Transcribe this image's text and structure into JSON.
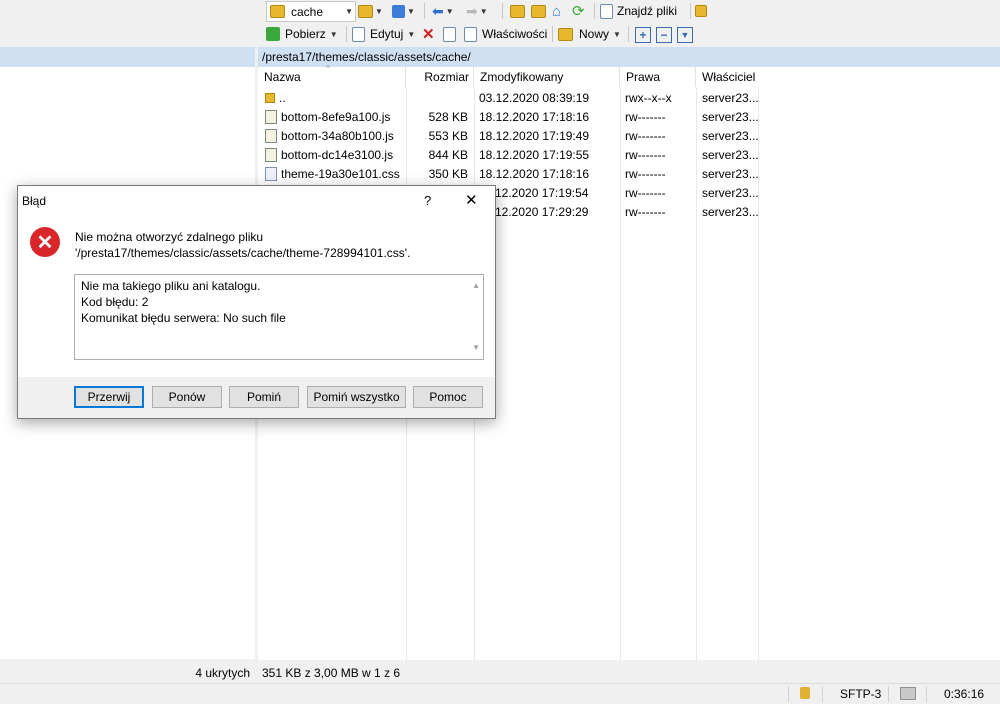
{
  "toolbar": {
    "location": "cache",
    "find_files": "Znajdź pliki",
    "download": "Pobierz",
    "edit": "Edytuj",
    "properties": "Właściwości",
    "new": "Nowy",
    "plus": "+",
    "minus": "−"
  },
  "path": "/presta17/themes/classic/assets/cache/",
  "columns": {
    "name": "Nazwa",
    "size": "Rozmiar",
    "modified": "Zmodyfikowany",
    "rights": "Prawa",
    "owner": "Właściciel"
  },
  "files": [
    {
      "name": "..",
      "size": "",
      "modified": "03.12.2020 08:39:19",
      "rights": "rwx--x--x",
      "owner": "server23..."
    },
    {
      "name": "bottom-8efe9a100.js",
      "size": "528 KB",
      "modified": "18.12.2020 17:18:16",
      "rights": "rw-------",
      "owner": "server23..."
    },
    {
      "name": "bottom-34a80b100.js",
      "size": "553 KB",
      "modified": "18.12.2020 17:19:49",
      "rights": "rw-------",
      "owner": "server23..."
    },
    {
      "name": "bottom-dc14e3100.js",
      "size": "844 KB",
      "modified": "18.12.2020 17:19:55",
      "rights": "rw-------",
      "owner": "server23..."
    },
    {
      "name": "theme-19a30e101.css",
      "size": "350 KB",
      "modified": "18.12.2020 17:18:16",
      "rights": "rw-------",
      "owner": "server23..."
    },
    {
      "name": "",
      "size": "",
      "modified": "12.2020 17:19:54",
      "rights": "rw-------",
      "owner": "server23..."
    },
    {
      "name": "",
      "size": "",
      "modified": "12.2020 17:29:29",
      "rights": "rw-------",
      "owner": "server23..."
    }
  ],
  "status": {
    "hidden": "4 ukrytych",
    "selection": "351 KB z 3,00 MB w 1 z 6",
    "protocol": "SFTP-3",
    "time": "0:36:16"
  },
  "dialog": {
    "title": "Błąd",
    "help": "?",
    "close": "✕",
    "message_line1": "Nie można otworzyć zdalnego pliku",
    "message_line2": "'/presta17/themes/classic/assets/cache/theme-728994101.css'.",
    "detail_line1": "Nie ma takiego pliku ani katalogu.",
    "detail_line2": "Kod błędu: 2",
    "detail_line3": "Komunikat błędu serwera: No such file",
    "buttons": [
      "Przerwij",
      "Ponów",
      "Pomiń",
      "Pomiń wszystko",
      "Pomoc"
    ]
  },
  "colors": {
    "accent": "#0078d7",
    "header_bg": "#cfe0f3",
    "error_red": "#d9262a"
  }
}
